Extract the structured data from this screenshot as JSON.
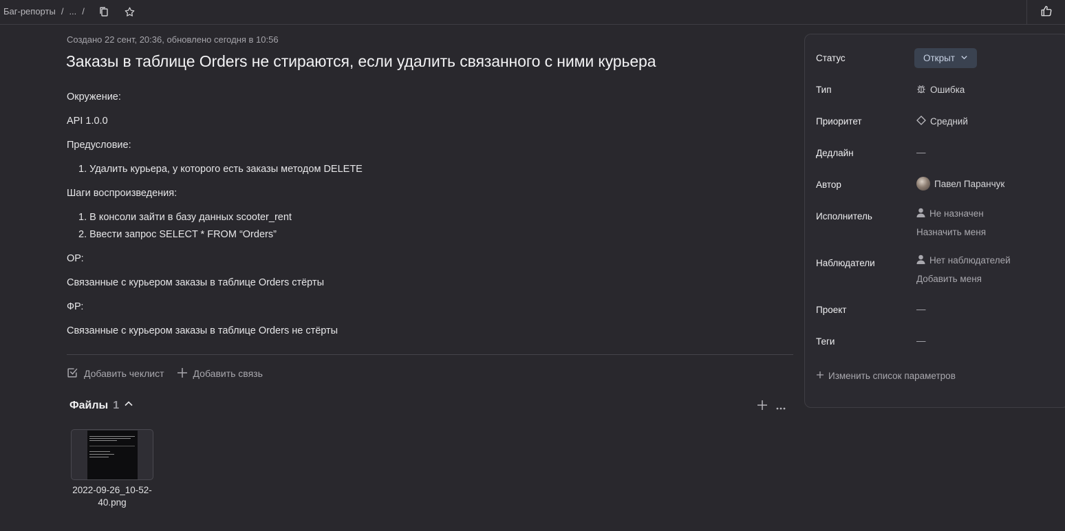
{
  "breadcrumbs": {
    "root": "Баг-репорты",
    "sep1": "/",
    "ellipsis": "...",
    "sep2": "/"
  },
  "topbar_icons": [
    "copy-icon",
    "star-icon",
    "thumbs-up-icon"
  ],
  "issue": {
    "meta": "Создано 22 сент, 20:36, обновлено сегодня в 10:56",
    "title": "Заказы в таблице Orders не стираются, если удалить связанного с ними курьера",
    "description": [
      "Окружение:",
      "API 1.0.0",
      "Предусловие:",
      "1. Удалить курьера, у которого есть заказы методом DELETE",
      "Шаги воспроизведения:",
      "1. В консоли зайти в базу данных scooter_rent",
      "2. Ввести запрос SELECT * FROM “Orders”",
      "ОР:",
      "Связанные с курьером заказы в таблице Orders стёрты",
      "ФР:",
      "Связанные с курьером заказы в таблице Orders не стёрты"
    ]
  },
  "actions": {
    "add_checklist": "Добавить чеклист",
    "add_link": "Добавить связь"
  },
  "files": {
    "title": "Файлы",
    "count": "1",
    "items": [
      {
        "name": "2022-09-26_10-52-40.png"
      }
    ]
  },
  "sidebar": {
    "status_label": "Статус",
    "status_value": "Открыт",
    "type_label": "Тип",
    "type_value": "Ошибка",
    "priority_label": "Приоритет",
    "priority_value": "Средний",
    "deadline_label": "Дедлайн",
    "deadline_value": "—",
    "author_label": "Автор",
    "author_value": "Павел Паранчук",
    "assignee_label": "Исполнитель",
    "assignee_value": "Не назначен",
    "assign_me": "Назначить меня",
    "watchers_label": "Наблюдатели",
    "watchers_value": "Нет наблюдателей",
    "add_me": "Добавить меня",
    "project_label": "Проект",
    "project_value": "—",
    "tags_label": "Теги",
    "tags_value": "—",
    "change_params": "Изменить список параметров"
  },
  "colors": {
    "background": "#29282d",
    "panel": "#2b2a30",
    "status_bg": "#3a4250",
    "status_text": "#c7d1e3"
  }
}
